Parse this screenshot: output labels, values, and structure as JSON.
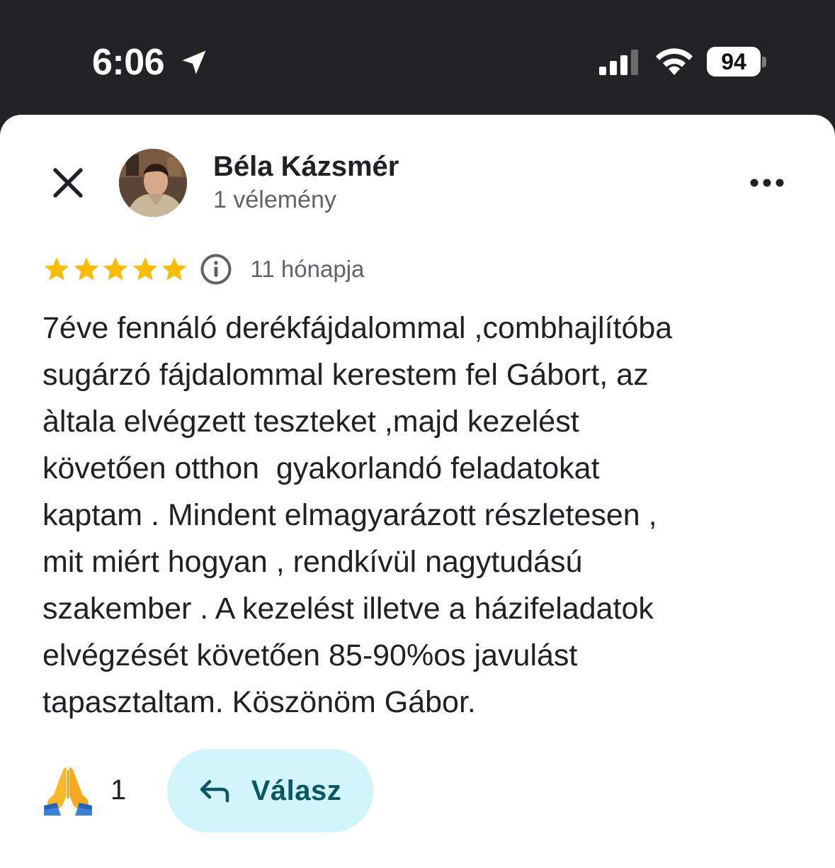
{
  "status_bar": {
    "time": "6:06",
    "battery_level": "94",
    "icons": [
      "location-arrow-icon",
      "cellular-signal-icon",
      "wifi-icon",
      "battery-icon"
    ]
  },
  "header": {
    "reviewer_name": "Béla Kázsmér",
    "reviewer_meta": "1 vélemény",
    "icons": [
      "close-icon",
      "avatar",
      "more-options-icon"
    ]
  },
  "review": {
    "rating": 5,
    "rating_max": 5,
    "date": "11 hónapja",
    "text": "7éve fennáló derékfájdalommal ,combhajlítóba\nsugárzó fájdalommal kerestem fel Gábort, az\nàltala elvégzett teszteket ,majd kezelést\nkövetően otthon  gyakorlandó feladatokat\nkaptam . Mindent elmagyarázott részletesen ,\nmit miért hogyan , rendkívül nagytudású\nszakember . A kezelést illetve a házifeladatok\nelvégzését követően 85-90%os javulást\ntapasztaltam. Köszönöm Gábor."
  },
  "reactions": {
    "emoji_icon": "folded-hands-icon",
    "count": "1"
  },
  "reply_button": {
    "label": "Válasz",
    "icon": "reply-arrow-icon"
  },
  "colors": {
    "status_bar_bg": "#232325",
    "star": "#fbbc04",
    "reply_bg": "#d2f4fb",
    "reply_text": "#0b5763",
    "primary_text": "#202124",
    "secondary_text": "#5f6368"
  }
}
